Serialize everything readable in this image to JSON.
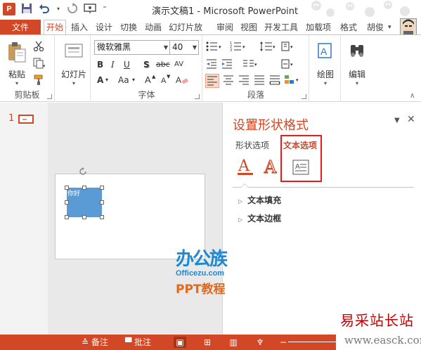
{
  "window": {
    "title": "演示文稿1 - Microsoft PowerPoint"
  },
  "qat": {
    "logo": "P",
    "icons": [
      "save-icon",
      "undo-icon",
      "redo-icon",
      "slideshow-icon",
      "customize-icon"
    ]
  },
  "tabs": {
    "file": "文件",
    "items": [
      "开始",
      "插入",
      "设计",
      "切换",
      "动画",
      "幻灯片放",
      "审阅",
      "视图",
      "开发工具",
      "加载项",
      "格式"
    ],
    "active": "开始",
    "user": "胡俊"
  },
  "ribbon": {
    "clipboard": {
      "label": "剪贴板",
      "paste": "粘贴"
    },
    "slides": {
      "label": "幻灯片"
    },
    "font": {
      "label": "字体",
      "font_name": "微软雅黑",
      "font_size": "40",
      "bold": "B",
      "italic": "I",
      "underline": "U",
      "shadow": "S",
      "strike": "abc",
      "spacing": "AV",
      "fontcolor": "A",
      "grow": "Aa"
    },
    "paragraph": {
      "label": "段落"
    },
    "drawing": {
      "label": "绘图"
    },
    "editing": {
      "label": "编辑"
    }
  },
  "thumbs": {
    "number": "1"
  },
  "slide": {
    "shape_text": "你好"
  },
  "watermark": {
    "cn": "办公族",
    "url": "Officezu.com",
    "sub": "PPT教程"
  },
  "pane": {
    "title": "设置形状格式",
    "tab_shape": "形状选项",
    "tab_text": "文本选项",
    "sections": [
      "文本填充",
      "文本边框"
    ]
  },
  "status": {
    "notes": "备注",
    "comments": "批注"
  },
  "overlay": {
    "brand": "易采站长站",
    "url": "www.easck.com"
  },
  "colors": {
    "accent": "#d24726",
    "shape": "#5b9bd5",
    "highlight": "#e31c1c"
  }
}
